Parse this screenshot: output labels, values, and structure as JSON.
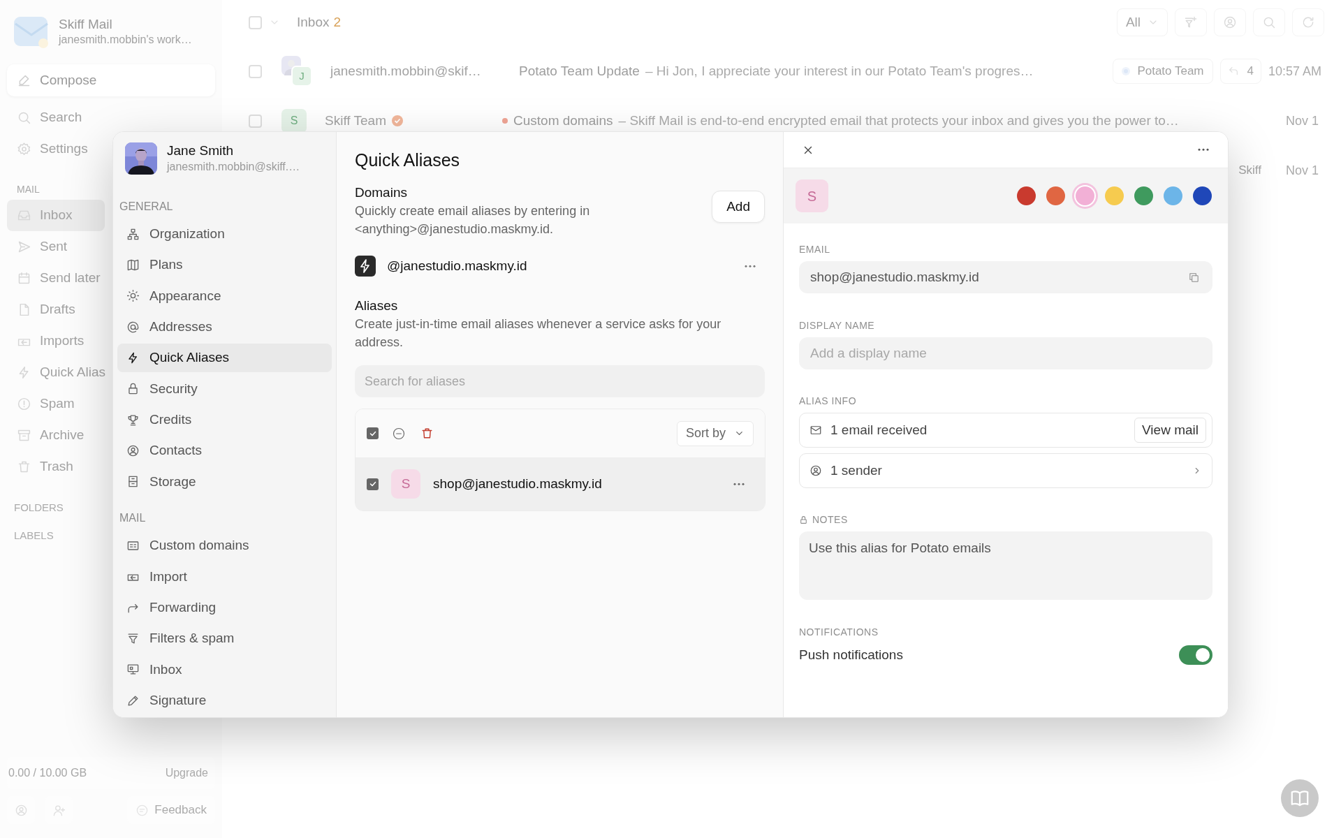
{
  "app": {
    "name": "Skiff Mail",
    "workspace": "janesmith.mobbin's work…"
  },
  "sidebar": {
    "compose": "Compose",
    "search": "Search",
    "settings": "Settings",
    "mail_heading": "MAIL",
    "items": [
      {
        "label": "Inbox",
        "selected": true
      },
      {
        "label": "Sent",
        "selected": false
      },
      {
        "label": "Send later",
        "selected": false
      },
      {
        "label": "Drafts",
        "selected": false
      },
      {
        "label": "Imports",
        "selected": false
      },
      {
        "label": "Quick Alias",
        "selected": false
      },
      {
        "label": "Spam",
        "selected": false
      },
      {
        "label": "Archive",
        "selected": false
      },
      {
        "label": "Trash",
        "selected": false
      }
    ],
    "folders_heading": "FOLDERS",
    "labels_heading": "LABELS",
    "storage": "0.00 / 10.00 GB",
    "upgrade": "Upgrade",
    "feedback": "Feedback"
  },
  "mail_list": {
    "title": "Inbox",
    "count": "2",
    "filter": "All",
    "select_all_checked": false,
    "messages": [
      {
        "checked": false,
        "sender": "janesmith.mobbin@skif…",
        "avatar_initial": "J",
        "verified": false,
        "unread": false,
        "subject": "Potato Team Update",
        "preview": "– Hi Jon, I appreciate your interest in our Potato Team's progres…",
        "label": "Potato Team",
        "replies": "4",
        "time": "10:57 AM"
      },
      {
        "checked": false,
        "sender": "Skiff Team",
        "avatar_initial": "S",
        "verified": true,
        "unread": true,
        "subject": "Custom domains",
        "preview": "– Skiff Mail is end-to-end encrypted email that protects your inbox and gives you the power to…",
        "time": "Nov 1"
      },
      {
        "label": "Skiff",
        "time": "Nov 1"
      }
    ]
  },
  "settings": {
    "user": {
      "name": "Jane Smith",
      "email": "janesmith.mobbin@skiff.…"
    },
    "groups": [
      {
        "heading": "GENERAL",
        "items": [
          {
            "label": "Organization",
            "selected": false
          },
          {
            "label": "Plans",
            "selected": false
          },
          {
            "label": "Appearance",
            "selected": false
          },
          {
            "label": "Addresses",
            "selected": false
          },
          {
            "label": "Quick Aliases",
            "selected": true
          },
          {
            "label": "Security",
            "selected": false
          },
          {
            "label": "Credits",
            "selected": false
          },
          {
            "label": "Contacts",
            "selected": false
          },
          {
            "label": "Storage",
            "selected": false
          }
        ]
      },
      {
        "heading": "MAIL",
        "items": [
          {
            "label": "Custom domains",
            "selected": false
          },
          {
            "label": "Import",
            "selected": false
          },
          {
            "label": "Forwarding",
            "selected": false
          },
          {
            "label": "Filters & spam",
            "selected": false
          },
          {
            "label": "Inbox",
            "selected": false
          },
          {
            "label": "Signature",
            "selected": false
          }
        ]
      }
    ]
  },
  "quick_aliases": {
    "title": "Quick Aliases",
    "domains": {
      "heading": "Domains",
      "description": "Quickly create email aliases by entering in <anything>@janestudio.maskmy.id.",
      "button": "Add",
      "domain": "@janestudio.maskmy.id"
    },
    "aliases": {
      "heading": "Aliases",
      "description": "Create just-in-time email aliases whenever a service asks for your address.",
      "search_placeholder": "Search for aliases",
      "select_all_checked": true,
      "sort": "Sort by",
      "rows": [
        {
          "initial": "S",
          "address": "shop@janestudio.maskmy.id",
          "checked": true
        }
      ]
    }
  },
  "alias_detail": {
    "initial": "S",
    "colors": [
      {
        "color": "#c93a2e",
        "selected": false
      },
      {
        "color": "#e06642",
        "selected": false
      },
      {
        "color": "#f2b0d6",
        "selected": true
      },
      {
        "color": "#f6cb4f",
        "selected": false
      },
      {
        "color": "#3f9a5e",
        "selected": false
      },
      {
        "color": "#6cb5e8",
        "selected": false
      },
      {
        "color": "#1f47b8",
        "selected": false
      }
    ],
    "email_label": "EMAIL",
    "email": "shop@janestudio.maskmy.id",
    "display_name_label": "DISPLAY NAME",
    "display_name_placeholder": "Add a display name",
    "alias_info_label": "ALIAS INFO",
    "received": "1 email received",
    "view_mail": "View mail",
    "senders": "1 sender",
    "notes_label": "NOTES",
    "notes": "Use this alias for Potato emails",
    "notifications_label": "NOTIFICATIONS",
    "push_notifications": {
      "label": "Push notifications",
      "on": true
    }
  }
}
